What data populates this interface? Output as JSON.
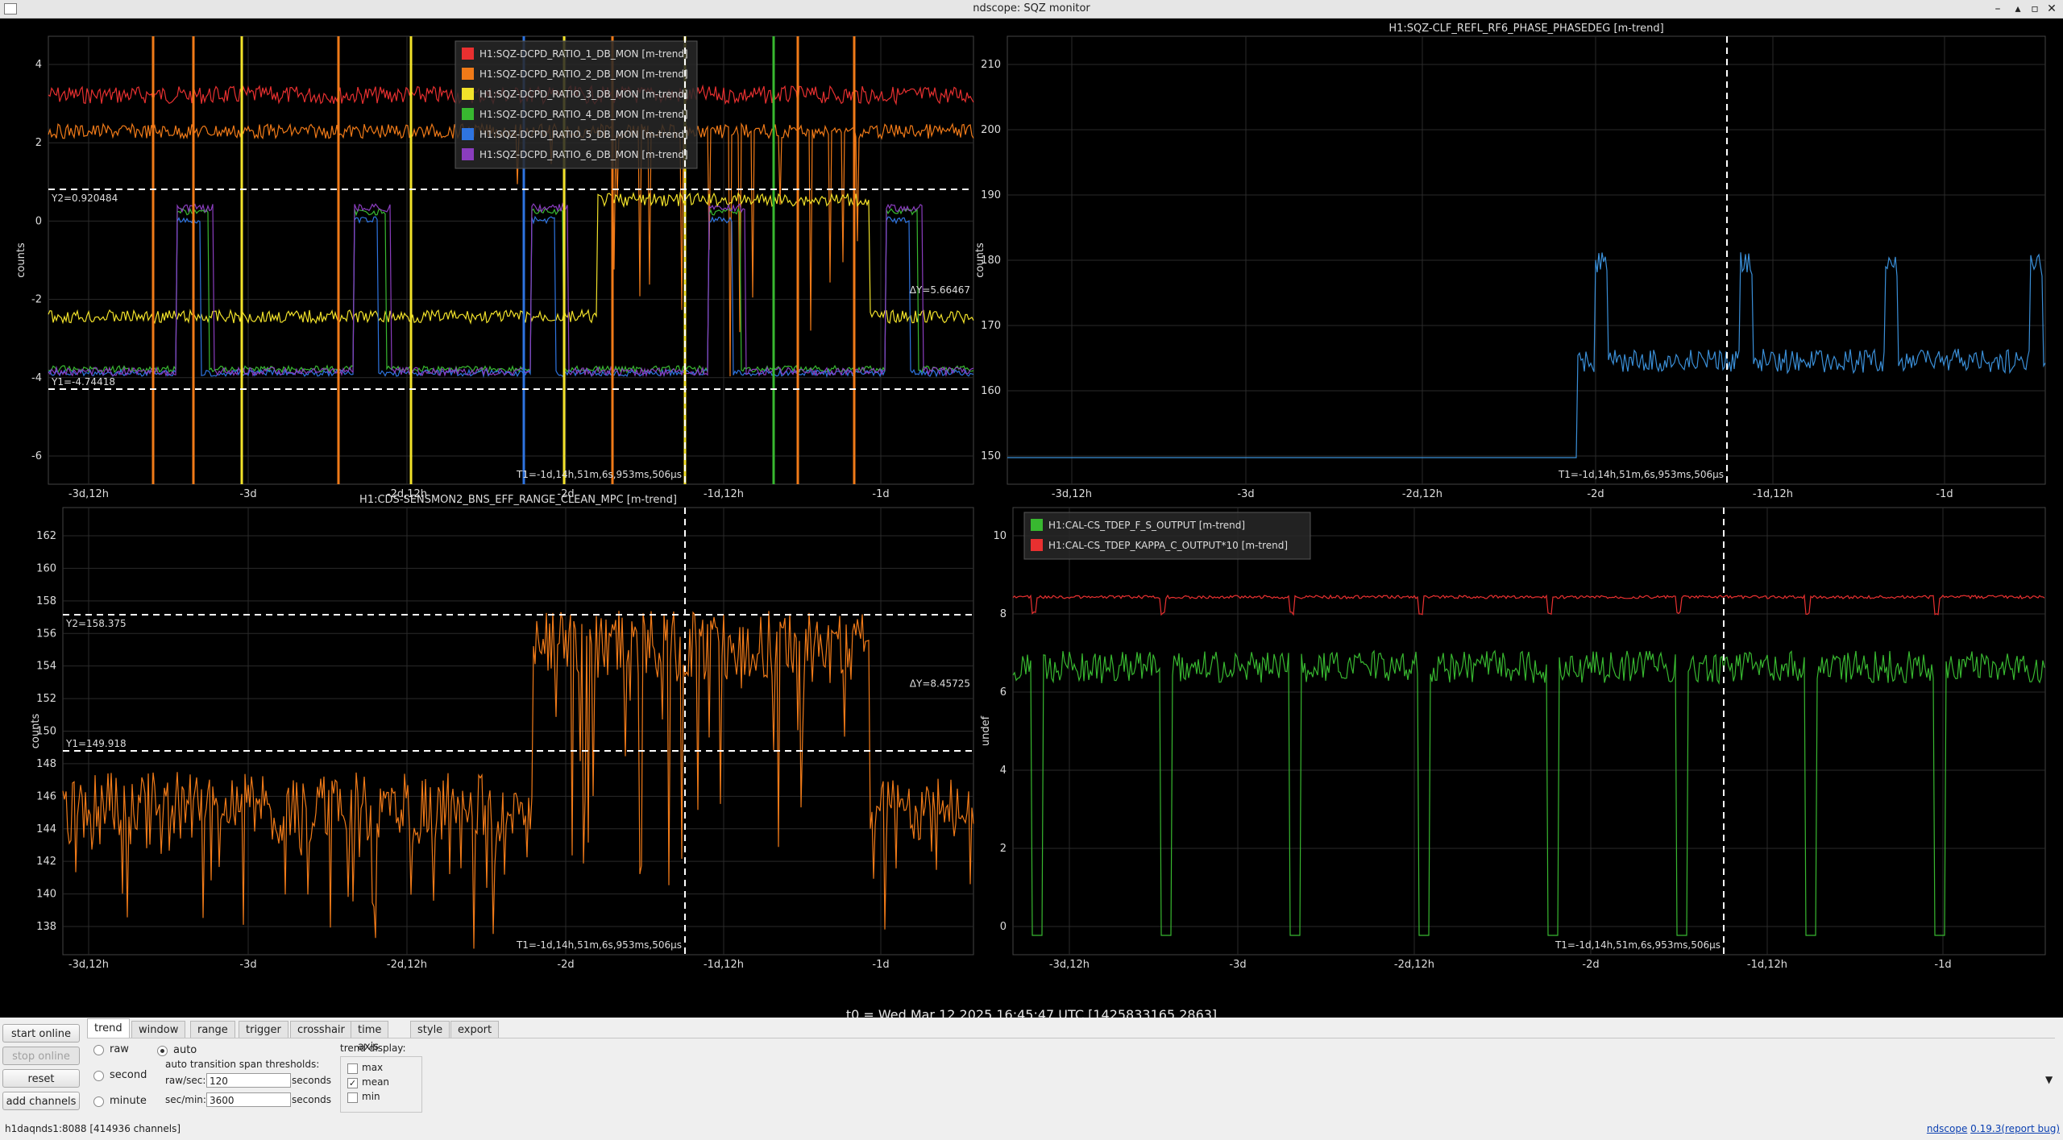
{
  "window": {
    "title": "ndscope: SQZ monitor"
  },
  "colors": {
    "red": "#e83030",
    "orange": "#f07a18",
    "yellow": "#f2e22a",
    "green": "#38b830",
    "blue": "#2e74e0",
    "purple": "#8a3dbe",
    "lightblue": "#3a8fd8",
    "plotbg": "#000000",
    "grid": "#2a2a2a",
    "cursor": "#ffffff"
  },
  "plots": [
    {
      "id": "plot-tl",
      "title": "",
      "ylabel": "counts",
      "yticks": [
        "4",
        "2",
        "0",
        "-2",
        "-4",
        "-6"
      ],
      "xticks": [
        "-3d,12h",
        "-3d",
        "-2d,12h",
        "-2d",
        "-1d,12h",
        "-1d"
      ],
      "legend": [
        {
          "label": "H1:SQZ-DCPD_RATIO_1_DB_MON [m-trend]",
          "color": "#e83030"
        },
        {
          "label": "H1:SQZ-DCPD_RATIO_2_DB_MON [m-trend]",
          "color": "#f07a18"
        },
        {
          "label": "H1:SQZ-DCPD_RATIO_3_DB_MON [m-trend]",
          "color": "#f2e22a"
        },
        {
          "label": "H1:SQZ-DCPD_RATIO_4_DB_MON [m-trend]",
          "color": "#38b830"
        },
        {
          "label": "H1:SQZ-DCPD_RATIO_5_DB_MON [m-trend]",
          "color": "#2e74e0"
        },
        {
          "label": "H1:SQZ-DCPD_RATIO_6_DB_MON [m-trend]",
          "color": "#8a3dbe"
        }
      ],
      "cursors": {
        "y2": "Y2=0.920484",
        "y1": "Y1=-4.74418",
        "dy": "ΔY=5.66467",
        "t1": "T1=-1d,14h,51m,6s,953ms,506µs"
      }
    },
    {
      "id": "plot-tr",
      "title": "H1:SQZ-CLF_REFL_RF6_PHASE_PHASEDEG [m-trend]",
      "ylabel": "counts",
      "yticks": [
        "210",
        "200",
        "190",
        "180",
        "170",
        "160",
        "150"
      ],
      "xticks": [
        "-3d,12h",
        "-3d",
        "-2d,12h",
        "-2d",
        "-1d,12h",
        "-1d"
      ],
      "legend": [],
      "cursors": {
        "t1": "T1=-1d,14h,51m,6s,953ms,506µs"
      }
    },
    {
      "id": "plot-bl",
      "title": "H1:CDS-SENSMON2_BNS_EFF_RANGE_CLEAN_MPC [m-trend]",
      "ylabel": "counts",
      "yticks": [
        "162",
        "160",
        "158",
        "156",
        "154",
        "152",
        "150",
        "148",
        "146",
        "144",
        "142",
        "140",
        "138"
      ],
      "xticks": [
        "-3d,12h",
        "-3d",
        "-2d,12h",
        "-2d",
        "-1d,12h",
        "-1d"
      ],
      "legend": [],
      "cursors": {
        "y2": "Y2=158.375",
        "y1": "Y1=149.918",
        "dy": "ΔY=8.45725",
        "t1": "T1=-1d,14h,51m,6s,953ms,506µs"
      }
    },
    {
      "id": "plot-br",
      "title": "",
      "ylabel": "undef",
      "yticks": [
        "10",
        "8",
        "6",
        "4",
        "2",
        "0"
      ],
      "xticks": [
        "-3d,12h",
        "-3d",
        "-2d,12h",
        "-2d",
        "-1d,12h",
        "-1d"
      ],
      "legend": [
        {
          "label": "H1:CAL-CS_TDEP_F_S_OUTPUT [m-trend]",
          "color": "#38b830"
        },
        {
          "label": "H1:CAL-CS_TDEP_KAPPA_C_OUTPUT*10 [m-trend]",
          "color": "#e83030"
        }
      ],
      "cursors": {
        "t1": "T1=-1d,14h,51m,6s,953ms,506µs"
      }
    }
  ],
  "t0": "t0 = Wed Mar 12 2025 16:45:47 UTC [1425833165.2863]",
  "buttons": {
    "start": "start online",
    "stop": "stop online",
    "reset": "reset",
    "add": "add channels"
  },
  "tabs": [
    "trend",
    "window",
    "range",
    "trigger",
    "crosshair",
    "time axis",
    "style",
    "export"
  ],
  "trend": {
    "modes": [
      "raw",
      "second",
      "minute"
    ],
    "auto": "auto",
    "thresholds_title": "auto transition span thresholds:",
    "raw_label": "raw/sec:",
    "raw_value": "120",
    "min_label": "sec/min:",
    "min_value": "3600",
    "unit": "seconds",
    "display_title": "trend display:",
    "display": [
      {
        "label": "max",
        "checked": false
      },
      {
        "label": "mean",
        "checked": true
      },
      {
        "label": "min",
        "checked": false
      }
    ]
  },
  "status": "h1daqnds1:8088  [414936 channels]",
  "version": {
    "name": "ndscope",
    "num": "0.19.3",
    "bug": "(report bug)"
  }
}
